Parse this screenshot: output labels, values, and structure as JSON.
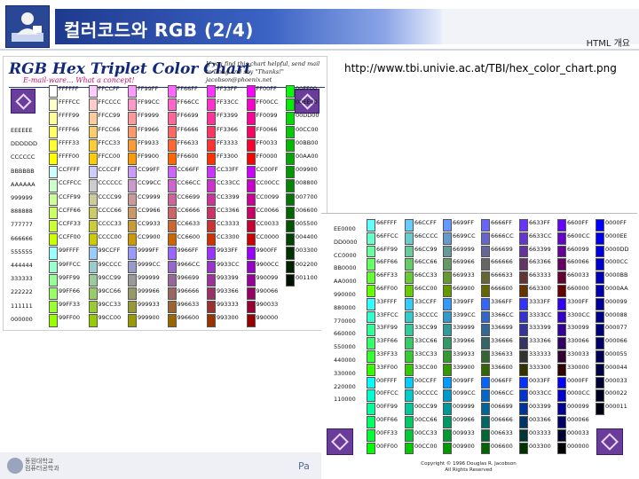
{
  "slide": {
    "title": "컬러코드와 RGB (2/4)",
    "section": "HTML 개요",
    "url": "http://www.tbi.univie.ac.at/TBI/hex_color_chart.png",
    "page_text": "Pa",
    "university_name": "동원대학교\n컴퓨터공학과"
  },
  "chart1": {
    "title": "RGB Hex Triplet Color Chart",
    "subtitle": "E-mail-ware... What a concept!",
    "note": "If you find this chart helpful, send mail to Doug and say \"Thanks!\" jacobson@phoenix.net",
    "left_column": [
      "EEEEEE",
      "DDDDDD",
      "CCCCCC",
      "BBBBBB",
      "AAAAAA",
      "999999",
      "888888",
      "777777",
      "666666",
      "555555",
      "444444",
      "333333",
      "222222",
      "111111",
      "000000"
    ],
    "columns": [
      {
        "cells": [
          [
            "FFFFFF",
            "#ffffff"
          ],
          [
            "FFFFCC",
            "#ffffcc"
          ],
          [
            "FFFF99",
            "#ffff99"
          ],
          [
            "FFFF66",
            "#ffff66"
          ],
          [
            "FFFF33",
            "#ffff33"
          ],
          [
            "FFFF00",
            "#ffff00"
          ],
          [
            "CCFFFF",
            "#ccffff"
          ],
          [
            "CCFFCC",
            "#ccffcc"
          ],
          [
            "CCFF99",
            "#ccff99"
          ],
          [
            "CCFF66",
            "#ccff66"
          ],
          [
            "CCFF33",
            "#ccff33"
          ],
          [
            "CCFF00",
            "#ccff00"
          ],
          [
            "99FFFF",
            "#99ffff"
          ],
          [
            "99FFCC",
            "#99ffcc"
          ],
          [
            "99FF99",
            "#99ff99"
          ],
          [
            "99FF66",
            "#99ff66"
          ],
          [
            "99FF33",
            "#99ff33"
          ],
          [
            "99FF00",
            "#99ff00"
          ]
        ]
      },
      {
        "cells": [
          [
            "FFCCFF",
            "#ffccff"
          ],
          [
            "FFCCCC",
            "#ffcccc"
          ],
          [
            "FFCC99",
            "#ffcc99"
          ],
          [
            "FFCC66",
            "#ffcc66"
          ],
          [
            "FFCC33",
            "#ffcc33"
          ],
          [
            "FFCC00",
            "#ffcc00"
          ],
          [
            "CCCCFF",
            "#ccccff"
          ],
          [
            "CCCCCC",
            "#cccccc"
          ],
          [
            "CCCC99",
            "#cccc99"
          ],
          [
            "CCCC66",
            "#cccc66"
          ],
          [
            "CCCC33",
            "#cccc33"
          ],
          [
            "CCCC00",
            "#cccc00"
          ],
          [
            "99CCFF",
            "#99ccff"
          ],
          [
            "99CCCC",
            "#99cccc"
          ],
          [
            "99CC99",
            "#99cc99"
          ],
          [
            "99CC66",
            "#99cc66"
          ],
          [
            "99CC33",
            "#99cc33"
          ],
          [
            "99CC00",
            "#99cc00"
          ]
        ]
      },
      {
        "cells": [
          [
            "FF99FF",
            "#ff99ff"
          ],
          [
            "FF99CC",
            "#ff99cc"
          ],
          [
            "FF9999",
            "#ff9999"
          ],
          [
            "FF9966",
            "#ff9966"
          ],
          [
            "FF9933",
            "#ff9933"
          ],
          [
            "FF9900",
            "#ff9900"
          ],
          [
            "CC99FF",
            "#cc99ff"
          ],
          [
            "CC99CC",
            "#cc99cc"
          ],
          [
            "CC9999",
            "#cc9999"
          ],
          [
            "CC9966",
            "#cc9966"
          ],
          [
            "CC9933",
            "#cc9933"
          ],
          [
            "CC9900",
            "#cc9900"
          ],
          [
            "9999FF",
            "#9999ff"
          ],
          [
            "9999CC",
            "#9999cc"
          ],
          [
            "999999",
            "#999999"
          ],
          [
            "999966",
            "#999966"
          ],
          [
            "999933",
            "#999933"
          ],
          [
            "999900",
            "#999900"
          ]
        ]
      },
      {
        "cells": [
          [
            "FF66FF",
            "#ff66ff"
          ],
          [
            "FF66CC",
            "#ff66cc"
          ],
          [
            "FF6699",
            "#ff6699"
          ],
          [
            "FF6666",
            "#ff6666"
          ],
          [
            "FF6633",
            "#ff6633"
          ],
          [
            "FF6600",
            "#ff6600"
          ],
          [
            "CC66FF",
            "#cc66ff"
          ],
          [
            "CC66CC",
            "#cc66cc"
          ],
          [
            "CC6699",
            "#cc6699"
          ],
          [
            "CC6666",
            "#cc6666"
          ],
          [
            "CC6633",
            "#cc6633"
          ],
          [
            "CC6600",
            "#cc6600"
          ],
          [
            "9966FF",
            "#9966ff"
          ],
          [
            "9966CC",
            "#9966cc"
          ],
          [
            "996699",
            "#996699"
          ],
          [
            "996666",
            "#996666"
          ],
          [
            "996633",
            "#996633"
          ],
          [
            "996600",
            "#996600"
          ]
        ]
      },
      {
        "cells": [
          [
            "FF33FF",
            "#ff33ff"
          ],
          [
            "FF33CC",
            "#ff33cc"
          ],
          [
            "FF3399",
            "#ff3399"
          ],
          [
            "FF3366",
            "#ff3366"
          ],
          [
            "FF3333",
            "#ff3333"
          ],
          [
            "FF3300",
            "#ff3300"
          ],
          [
            "CC33FF",
            "#cc33ff"
          ],
          [
            "CC33CC",
            "#cc33cc"
          ],
          [
            "CC3399",
            "#cc3399"
          ],
          [
            "CC3366",
            "#cc3366"
          ],
          [
            "CC3333",
            "#cc3333"
          ],
          [
            "CC3300",
            "#cc3300"
          ],
          [
            "9933FF",
            "#9933ff"
          ],
          [
            "9933CC",
            "#9933cc"
          ],
          [
            "993399",
            "#993399"
          ],
          [
            "993366",
            "#993366"
          ],
          [
            "993333",
            "#993333"
          ],
          [
            "993300",
            "#993300"
          ]
        ]
      },
      {
        "cells": [
          [
            "FF00FF",
            "#ff00ff"
          ],
          [
            "FF00CC",
            "#ff00cc"
          ],
          [
            "FF0099",
            "#ff0099"
          ],
          [
            "FF0066",
            "#ff0066"
          ],
          [
            "FF0033",
            "#ff0033"
          ],
          [
            "FF0000",
            "#ff0000"
          ],
          [
            "CC00FF",
            "#cc00ff"
          ],
          [
            "CC00CC",
            "#cc00cc"
          ],
          [
            "CC0099",
            "#cc0099"
          ],
          [
            "CC0066",
            "#cc0066"
          ],
          [
            "CC0033",
            "#cc0033"
          ],
          [
            "CC0000",
            "#cc0000"
          ],
          [
            "9900FF",
            "#9900ff"
          ],
          [
            "9900CC",
            "#9900cc"
          ],
          [
            "990099",
            "#990099"
          ],
          [
            "990066",
            "#990066"
          ],
          [
            "990033",
            "#990033"
          ],
          [
            "990000",
            "#990000"
          ]
        ]
      },
      {
        "cells": [
          [
            "00FF00",
            "#00ff00"
          ],
          [
            "00EE00",
            "#00ee00"
          ],
          [
            "00DD00",
            "#00dd00"
          ],
          [
            "00CC00",
            "#00cc00"
          ],
          [
            "00BB00",
            "#00bb00"
          ],
          [
            "00AA00",
            "#00aa00"
          ],
          [
            "009900",
            "#009900"
          ],
          [
            "008800",
            "#008800"
          ],
          [
            "007700",
            "#007700"
          ],
          [
            "006600",
            "#006600"
          ],
          [
            "005500",
            "#005500"
          ],
          [
            "004400",
            "#004400"
          ],
          [
            "003300",
            "#003300"
          ],
          [
            "002200",
            "#002200"
          ],
          [
            "001100",
            "#001100"
          ]
        ]
      }
    ]
  },
  "chart2": {
    "left_column": [
      "EE0000",
      "DD0000",
      "CC0000",
      "BB0000",
      "AA0000",
      "990000",
      "880000",
      "770000",
      "660000",
      "550000",
      "440000",
      "330000",
      "220000",
      "110000"
    ],
    "columns": [
      {
        "cells": [
          [
            "66FFFF",
            "#66ffff"
          ],
          [
            "66FFCC",
            "#66ffcc"
          ],
          [
            "66FF99",
            "#66ff99"
          ],
          [
            "66FF66",
            "#66ff66"
          ],
          [
            "66FF33",
            "#66ff33"
          ],
          [
            "66FF00",
            "#66ff00"
          ],
          [
            "33FFFF",
            "#33ffff"
          ],
          [
            "33FFCC",
            "#33ffcc"
          ],
          [
            "33FF99",
            "#33ff99"
          ],
          [
            "33FF66",
            "#33ff66"
          ],
          [
            "33FF33",
            "#33ff33"
          ],
          [
            "33FF00",
            "#33ff00"
          ],
          [
            "00FFFF",
            "#00ffff"
          ],
          [
            "00FFCC",
            "#00ffcc"
          ],
          [
            "00FF99",
            "#00ff99"
          ],
          [
            "00FF66",
            "#00ff66"
          ],
          [
            "00FF33",
            "#00ff33"
          ],
          [
            "00FF00",
            "#00ff00"
          ]
        ]
      },
      {
        "cells": [
          [
            "66CCFF",
            "#66ccff"
          ],
          [
            "66CCCC",
            "#66cccc"
          ],
          [
            "66CC99",
            "#66cc99"
          ],
          [
            "66CC66",
            "#66cc66"
          ],
          [
            "66CC33",
            "#66cc33"
          ],
          [
            "66CC00",
            "#66cc00"
          ],
          [
            "33CCFF",
            "#33ccff"
          ],
          [
            "33CCCC",
            "#33cccc"
          ],
          [
            "33CC99",
            "#33cc99"
          ],
          [
            "33CC66",
            "#33cc66"
          ],
          [
            "33CC33",
            "#33cc33"
          ],
          [
            "33CC00",
            "#33cc00"
          ],
          [
            "00CCFF",
            "#00ccff"
          ],
          [
            "00CCCC",
            "#00cccc"
          ],
          [
            "00CC99",
            "#00cc99"
          ],
          [
            "00CC66",
            "#00cc66"
          ],
          [
            "00CC33",
            "#00cc33"
          ],
          [
            "00CC00",
            "#00cc00"
          ]
        ]
      },
      {
        "cells": [
          [
            "6699FF",
            "#6699ff"
          ],
          [
            "6699CC",
            "#6699cc"
          ],
          [
            "669999",
            "#669999"
          ],
          [
            "669966",
            "#669966"
          ],
          [
            "669933",
            "#669933"
          ],
          [
            "669900",
            "#669900"
          ],
          [
            "3399FF",
            "#3399ff"
          ],
          [
            "3399CC",
            "#3399cc"
          ],
          [
            "339999",
            "#339999"
          ],
          [
            "339966",
            "#339966"
          ],
          [
            "339933",
            "#339933"
          ],
          [
            "339900",
            "#339900"
          ],
          [
            "0099FF",
            "#0099ff"
          ],
          [
            "0099CC",
            "#0099cc"
          ],
          [
            "009999",
            "#009999"
          ],
          [
            "009966",
            "#009966"
          ],
          [
            "009933",
            "#009933"
          ],
          [
            "009900",
            "#009900"
          ]
        ]
      },
      {
        "cells": [
          [
            "6666FF",
            "#6666ff"
          ],
          [
            "6666CC",
            "#6666cc"
          ],
          [
            "666699",
            "#666699"
          ],
          [
            "666666",
            "#666666"
          ],
          [
            "666633",
            "#666633"
          ],
          [
            "666600",
            "#666600"
          ],
          [
            "3366FF",
            "#3366ff"
          ],
          [
            "3366CC",
            "#3366cc"
          ],
          [
            "336699",
            "#336699"
          ],
          [
            "336666",
            "#336666"
          ],
          [
            "336633",
            "#336633"
          ],
          [
            "336600",
            "#336600"
          ],
          [
            "0066FF",
            "#0066ff"
          ],
          [
            "0066CC",
            "#0066cc"
          ],
          [
            "006699",
            "#006699"
          ],
          [
            "006666",
            "#006666"
          ],
          [
            "006633",
            "#006633"
          ],
          [
            "006600",
            "#006600"
          ]
        ]
      },
      {
        "cells": [
          [
            "6633FF",
            "#6633ff"
          ],
          [
            "6633CC",
            "#6633cc"
          ],
          [
            "663399",
            "#663399"
          ],
          [
            "663366",
            "#663366"
          ],
          [
            "663333",
            "#663333"
          ],
          [
            "663300",
            "#663300"
          ],
          [
            "3333FF",
            "#3333ff"
          ],
          [
            "3333CC",
            "#3333cc"
          ],
          [
            "333399",
            "#333399"
          ],
          [
            "333366",
            "#333366"
          ],
          [
            "333333",
            "#333333"
          ],
          [
            "333300",
            "#333300"
          ],
          [
            "0033FF",
            "#0033ff"
          ],
          [
            "0033CC",
            "#0033cc"
          ],
          [
            "003399",
            "#003399"
          ],
          [
            "003366",
            "#003366"
          ],
          [
            "003333",
            "#003333"
          ],
          [
            "003300",
            "#003300"
          ]
        ]
      },
      {
        "cells": [
          [
            "6600FF",
            "#6600ff"
          ],
          [
            "6600CC",
            "#6600cc"
          ],
          [
            "660099",
            "#660099"
          ],
          [
            "660066",
            "#660066"
          ],
          [
            "660033",
            "#660033"
          ],
          [
            "660000",
            "#660000"
          ],
          [
            "3300FF",
            "#3300ff"
          ],
          [
            "3300CC",
            "#3300cc"
          ],
          [
            "330099",
            "#330099"
          ],
          [
            "330066",
            "#330066"
          ],
          [
            "330033",
            "#330033"
          ],
          [
            "330000",
            "#330000"
          ],
          [
            "0000FF",
            "#0000ff"
          ],
          [
            "0000CC",
            "#0000cc"
          ],
          [
            "000099",
            "#000099"
          ],
          [
            "000066",
            "#000066"
          ],
          [
            "000033",
            "#000033"
          ],
          [
            "000000",
            "#000000"
          ]
        ]
      },
      {
        "cells": [
          [
            "0000FF",
            "#0000ff"
          ],
          [
            "0000EE",
            "#0000ee"
          ],
          [
            "0000DD",
            "#0000dd"
          ],
          [
            "0000CC",
            "#0000cc"
          ],
          [
            "0000BB",
            "#0000bb"
          ],
          [
            "0000AA",
            "#0000aa"
          ],
          [
            "000099",
            "#000099"
          ],
          [
            "000088",
            "#000088"
          ],
          [
            "000077",
            "#000077"
          ],
          [
            "000066",
            "#000066"
          ],
          [
            "000055",
            "#000055"
          ],
          [
            "000044",
            "#000044"
          ],
          [
            "000033",
            "#000033"
          ],
          [
            "000022",
            "#000022"
          ],
          [
            "000011",
            "#000011"
          ]
        ]
      }
    ],
    "copyright": "Copyright © 1996 Douglas R. Jacobson\nAll Rights Reserved"
  }
}
